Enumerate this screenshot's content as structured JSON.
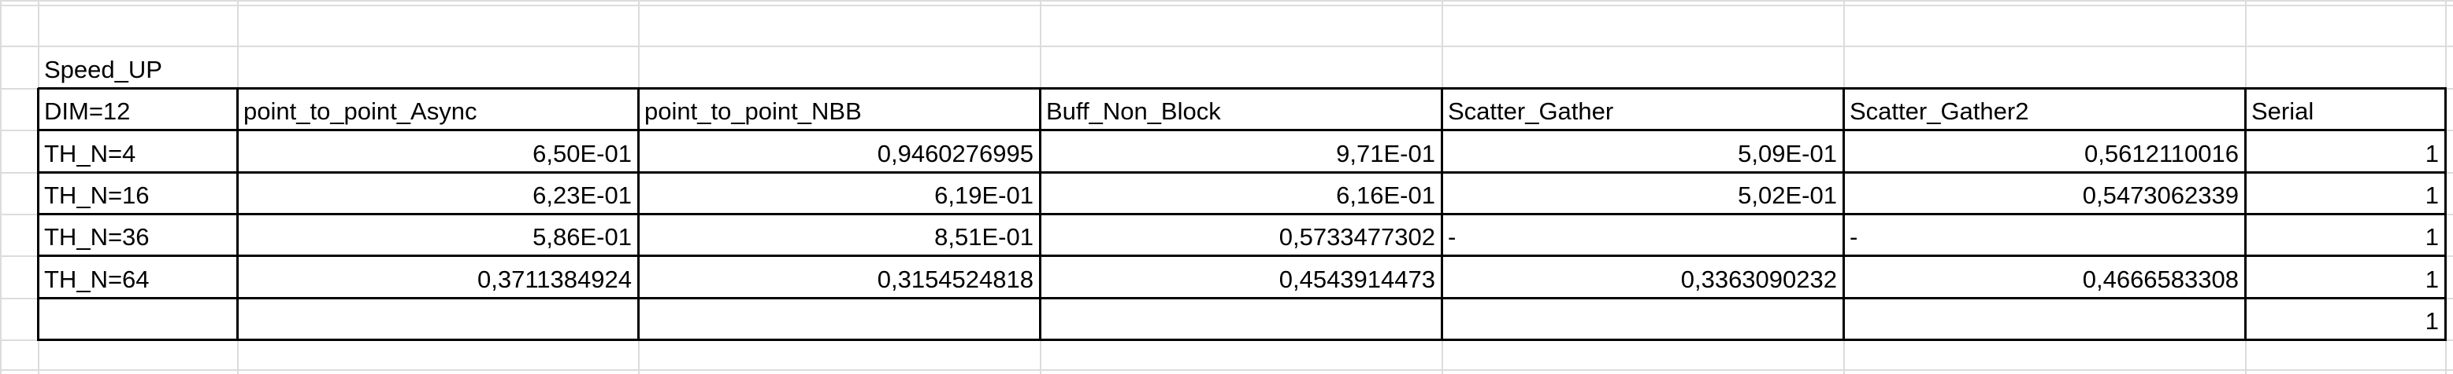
{
  "sheet": {
    "caption": "Speed_UP",
    "headers": [
      "DIM=12",
      "point_to_point_Async",
      "point_to_point_NBB",
      "Buff_Non_Block",
      "Scatter_Gather",
      "Scatter_Gather2",
      "Serial"
    ],
    "rows": [
      [
        "TH_N=4",
        "6,50E-01",
        "0,9460276995",
        "9,71E-01",
        "5,09E-01",
        "0,5612110016",
        "1"
      ],
      [
        "TH_N=16",
        "6,23E-01",
        "6,19E-01",
        "6,16E-01",
        "5,02E-01",
        "0,5473062339",
        "1"
      ],
      [
        "TH_N=36",
        "5,86E-01",
        "8,51E-01",
        "0,5733477302",
        "-",
        "-",
        "1"
      ],
      [
        "TH_N=64",
        "0,3711384924",
        "0,3154524818",
        "0,4543914473",
        "0,3363090232",
        "0,4666583308",
        "1"
      ],
      [
        "",
        "",
        "",
        "",
        "",
        "",
        "1"
      ]
    ]
  }
}
